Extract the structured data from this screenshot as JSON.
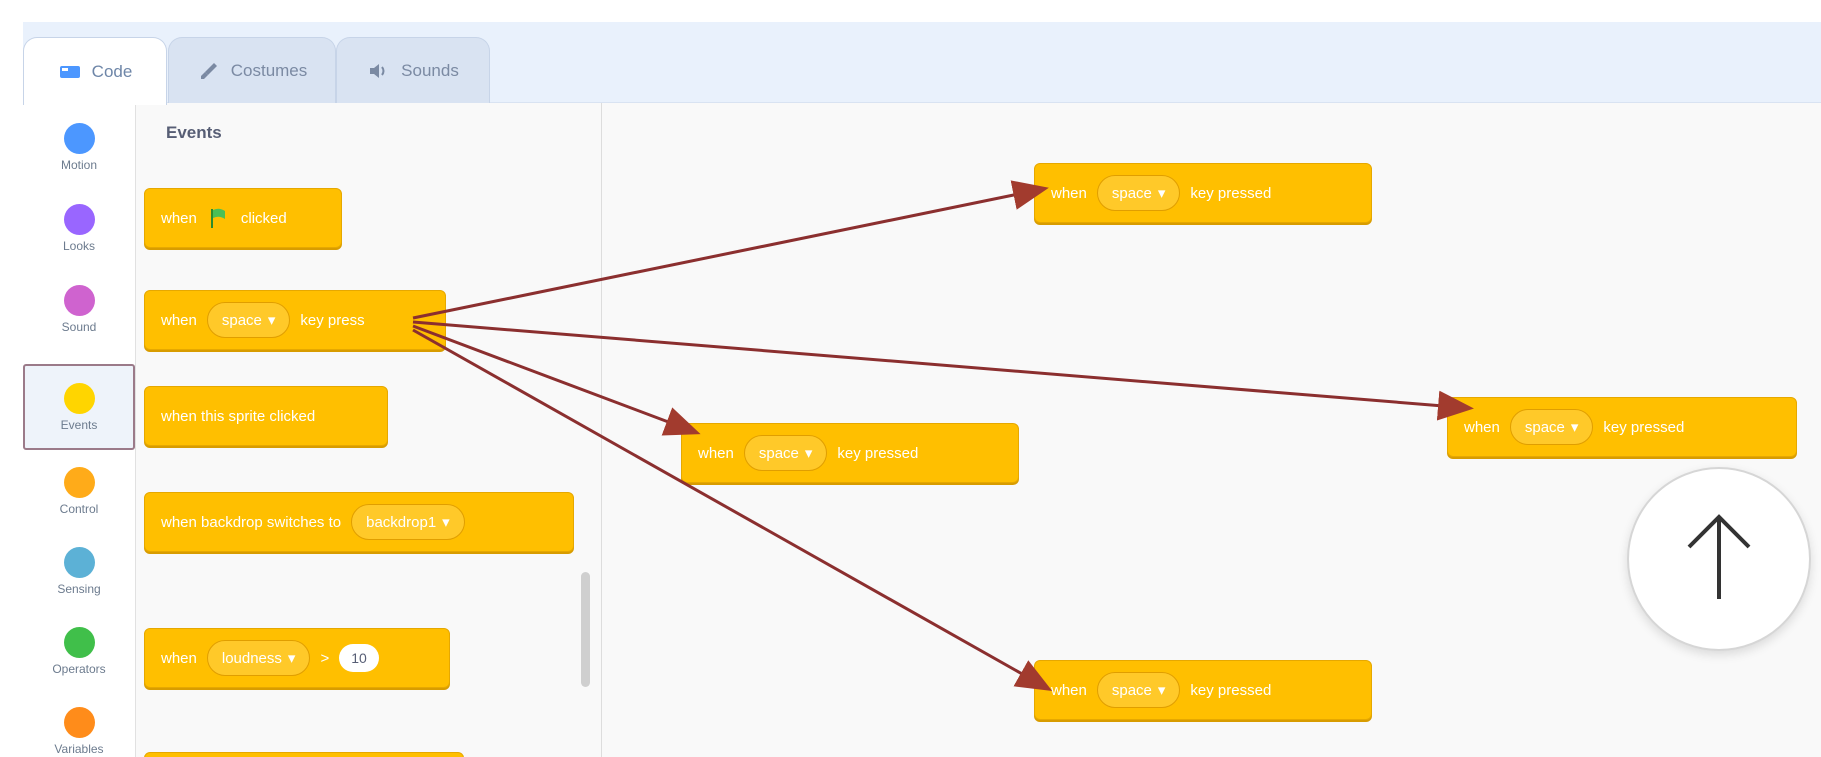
{
  "tabs": [
    {
      "label": "Code",
      "icon": "code-icon",
      "active": true
    },
    {
      "label": "Costumes",
      "icon": "paintbrush-icon",
      "active": false
    },
    {
      "label": "Sounds",
      "icon": "speaker-icon",
      "active": false
    }
  ],
  "categories": [
    {
      "label": "Motion",
      "color": "#4c97ff"
    },
    {
      "label": "Looks",
      "color": "#9966ff"
    },
    {
      "label": "Sound",
      "color": "#cf63cf"
    },
    {
      "label": "Events",
      "color": "#ffd500",
      "selected": true
    },
    {
      "label": "Control",
      "color": "#ffab19"
    },
    {
      "label": "Sensing",
      "color": "#5cb1d6"
    },
    {
      "label": "Operators",
      "color": "#40bf4a"
    },
    {
      "label": "Variables",
      "color": "#ff8c1a"
    }
  ],
  "palette": {
    "title": "Events",
    "blocks": {
      "flag": {
        "prefix": "when",
        "suffix": "clicked"
      },
      "key": {
        "prefix": "when",
        "dropdown": "space",
        "suffix": "key press"
      },
      "sprite": {
        "text": "when this sprite clicked"
      },
      "backdrop": {
        "text": "when backdrop switches to",
        "dropdown": "backdrop1"
      },
      "loudness": {
        "prefix": "when",
        "dropdown": "loudness",
        "operator": ">",
        "value": "10"
      }
    }
  },
  "workspace": {
    "blocks": [
      {
        "prefix": "when",
        "dropdown": "space",
        "suffix": "key pressed"
      },
      {
        "prefix": "when",
        "dropdown": "space",
        "suffix": "key pressed"
      },
      {
        "prefix": "when",
        "dropdown": "space",
        "suffix": "key pressed"
      },
      {
        "prefix": "when",
        "dropdown": "space",
        "suffix": "key pressed"
      }
    ]
  },
  "colors": {
    "event_block": "#ffbf00",
    "arrow": "#8b2f2f",
    "tab_bg": "#e9f1fc"
  }
}
